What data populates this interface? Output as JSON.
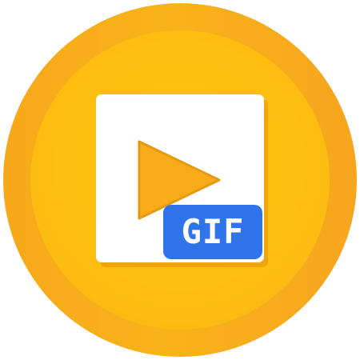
{
  "icon": {
    "name": "gif-video-file-icon",
    "badge_label": "GIF",
    "colors": {
      "outer_ring": "#f9b01a",
      "inner_disc": "#fec20d",
      "card": "#ffffff",
      "card_shadow": "#e6900f",
      "play_fill": "#f8ad18",
      "play_stroke": "#e6990f",
      "badge": "#2f74ea",
      "badge_text": "#ffffff"
    }
  }
}
